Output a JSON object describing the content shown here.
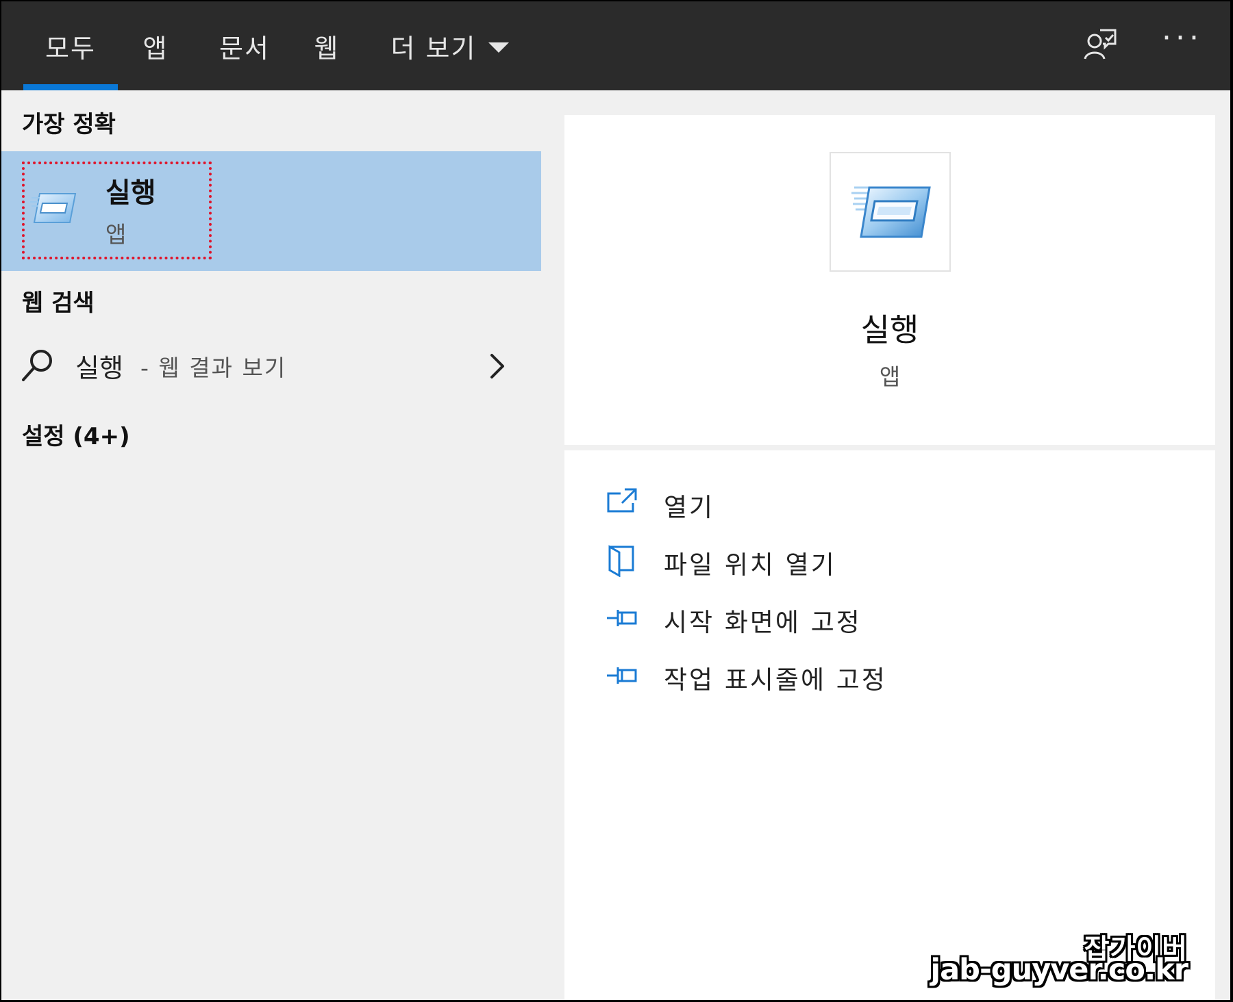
{
  "tabs": [
    {
      "label": "모두",
      "active": true
    },
    {
      "label": "앱"
    },
    {
      "label": "문서"
    },
    {
      "label": "웹"
    },
    {
      "label": "더 보기"
    }
  ],
  "header_icons": [
    "feedback-icon",
    "more-options-icon"
  ],
  "left": {
    "best_match_heading": "가장 정확",
    "best_match": {
      "title": "실행",
      "subtitle": "앱",
      "icon": "run-app-icon"
    },
    "web_search_heading": "웹 검색",
    "web_search": {
      "query": "실행",
      "suffix": "- 웹 결과 보기"
    },
    "settings_heading": "설정 (4+)"
  },
  "preview": {
    "title": "실행",
    "subtitle": "앱",
    "actions": [
      {
        "label": "열기",
        "icon": "open-icon"
      },
      {
        "label": "파일 위치 열기",
        "icon": "file-location-icon"
      },
      {
        "label": "시작 화면에 고정",
        "icon": "pin-icon"
      },
      {
        "label": "작업 표시줄에 고정",
        "icon": "pin-icon"
      }
    ]
  },
  "watermark": {
    "line1": "잡가이버",
    "line2": "jab-guyver.co.kr"
  },
  "colors": {
    "topbar": "#2b2b2b",
    "accent": "#0a78d7",
    "selection": "#a9cbea",
    "focus_outline": "#e0142a"
  }
}
